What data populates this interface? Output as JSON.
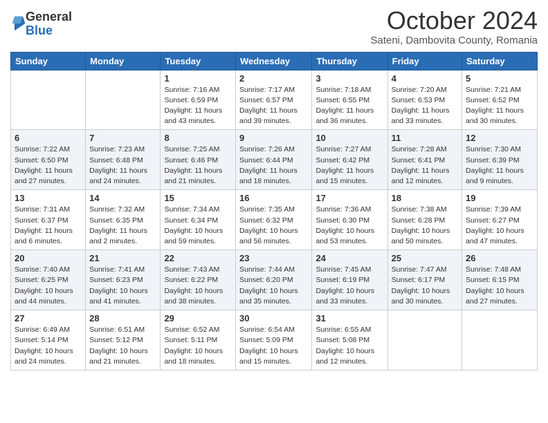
{
  "logo": {
    "general": "General",
    "blue": "Blue"
  },
  "title": "October 2024",
  "location": "Sateni, Dambovita County, Romania",
  "days_header": [
    "Sunday",
    "Monday",
    "Tuesday",
    "Wednesday",
    "Thursday",
    "Friday",
    "Saturday"
  ],
  "weeks": [
    [
      {
        "day": "",
        "info": ""
      },
      {
        "day": "",
        "info": ""
      },
      {
        "day": "1",
        "info": "Sunrise: 7:16 AM\nSunset: 6:59 PM\nDaylight: 11 hours and 43 minutes."
      },
      {
        "day": "2",
        "info": "Sunrise: 7:17 AM\nSunset: 6:57 PM\nDaylight: 11 hours and 39 minutes."
      },
      {
        "day": "3",
        "info": "Sunrise: 7:18 AM\nSunset: 6:55 PM\nDaylight: 11 hours and 36 minutes."
      },
      {
        "day": "4",
        "info": "Sunrise: 7:20 AM\nSunset: 6:53 PM\nDaylight: 11 hours and 33 minutes."
      },
      {
        "day": "5",
        "info": "Sunrise: 7:21 AM\nSunset: 6:52 PM\nDaylight: 11 hours and 30 minutes."
      }
    ],
    [
      {
        "day": "6",
        "info": "Sunrise: 7:22 AM\nSunset: 6:50 PM\nDaylight: 11 hours and 27 minutes."
      },
      {
        "day": "7",
        "info": "Sunrise: 7:23 AM\nSunset: 6:48 PM\nDaylight: 11 hours and 24 minutes."
      },
      {
        "day": "8",
        "info": "Sunrise: 7:25 AM\nSunset: 6:46 PM\nDaylight: 11 hours and 21 minutes."
      },
      {
        "day": "9",
        "info": "Sunrise: 7:26 AM\nSunset: 6:44 PM\nDaylight: 11 hours and 18 minutes."
      },
      {
        "day": "10",
        "info": "Sunrise: 7:27 AM\nSunset: 6:42 PM\nDaylight: 11 hours and 15 minutes."
      },
      {
        "day": "11",
        "info": "Sunrise: 7:28 AM\nSunset: 6:41 PM\nDaylight: 11 hours and 12 minutes."
      },
      {
        "day": "12",
        "info": "Sunrise: 7:30 AM\nSunset: 6:39 PM\nDaylight: 11 hours and 9 minutes."
      }
    ],
    [
      {
        "day": "13",
        "info": "Sunrise: 7:31 AM\nSunset: 6:37 PM\nDaylight: 11 hours and 6 minutes."
      },
      {
        "day": "14",
        "info": "Sunrise: 7:32 AM\nSunset: 6:35 PM\nDaylight: 11 hours and 2 minutes."
      },
      {
        "day": "15",
        "info": "Sunrise: 7:34 AM\nSunset: 6:34 PM\nDaylight: 10 hours and 59 minutes."
      },
      {
        "day": "16",
        "info": "Sunrise: 7:35 AM\nSunset: 6:32 PM\nDaylight: 10 hours and 56 minutes."
      },
      {
        "day": "17",
        "info": "Sunrise: 7:36 AM\nSunset: 6:30 PM\nDaylight: 10 hours and 53 minutes."
      },
      {
        "day": "18",
        "info": "Sunrise: 7:38 AM\nSunset: 6:28 PM\nDaylight: 10 hours and 50 minutes."
      },
      {
        "day": "19",
        "info": "Sunrise: 7:39 AM\nSunset: 6:27 PM\nDaylight: 10 hours and 47 minutes."
      }
    ],
    [
      {
        "day": "20",
        "info": "Sunrise: 7:40 AM\nSunset: 6:25 PM\nDaylight: 10 hours and 44 minutes."
      },
      {
        "day": "21",
        "info": "Sunrise: 7:41 AM\nSunset: 6:23 PM\nDaylight: 10 hours and 41 minutes."
      },
      {
        "day": "22",
        "info": "Sunrise: 7:43 AM\nSunset: 6:22 PM\nDaylight: 10 hours and 38 minutes."
      },
      {
        "day": "23",
        "info": "Sunrise: 7:44 AM\nSunset: 6:20 PM\nDaylight: 10 hours and 35 minutes."
      },
      {
        "day": "24",
        "info": "Sunrise: 7:45 AM\nSunset: 6:19 PM\nDaylight: 10 hours and 33 minutes."
      },
      {
        "day": "25",
        "info": "Sunrise: 7:47 AM\nSunset: 6:17 PM\nDaylight: 10 hours and 30 minutes."
      },
      {
        "day": "26",
        "info": "Sunrise: 7:48 AM\nSunset: 6:15 PM\nDaylight: 10 hours and 27 minutes."
      }
    ],
    [
      {
        "day": "27",
        "info": "Sunrise: 6:49 AM\nSunset: 5:14 PM\nDaylight: 10 hours and 24 minutes."
      },
      {
        "day": "28",
        "info": "Sunrise: 6:51 AM\nSunset: 5:12 PM\nDaylight: 10 hours and 21 minutes."
      },
      {
        "day": "29",
        "info": "Sunrise: 6:52 AM\nSunset: 5:11 PM\nDaylight: 10 hours and 18 minutes."
      },
      {
        "day": "30",
        "info": "Sunrise: 6:54 AM\nSunset: 5:09 PM\nDaylight: 10 hours and 15 minutes."
      },
      {
        "day": "31",
        "info": "Sunrise: 6:55 AM\nSunset: 5:08 PM\nDaylight: 10 hours and 12 minutes."
      },
      {
        "day": "",
        "info": ""
      },
      {
        "day": "",
        "info": ""
      }
    ]
  ]
}
